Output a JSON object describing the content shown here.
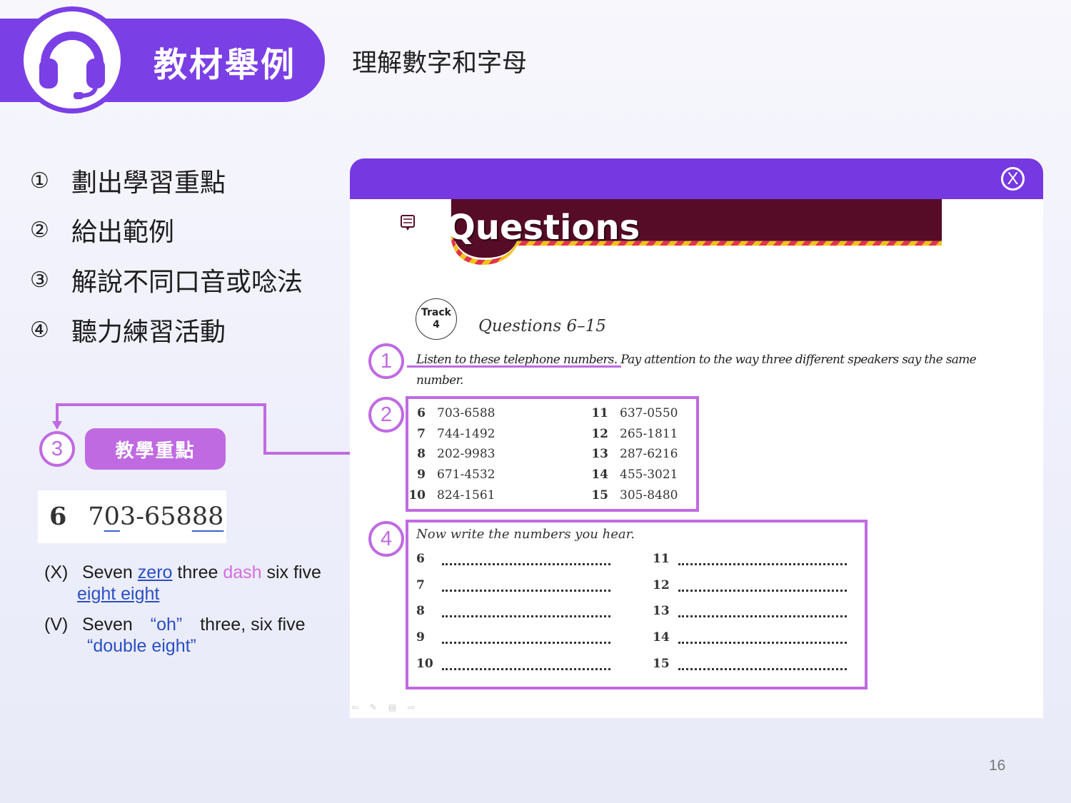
{
  "header": {
    "title": "教材舉例",
    "subtitle": "理解數字和字母",
    "icon": "headset-icon",
    "accent_color": "#7b3fe6"
  },
  "steps": [
    {
      "num": "①",
      "label": "劃出學習重點"
    },
    {
      "num": "②",
      "label": "給出範例"
    },
    {
      "num": "③",
      "label": "解說不同口音或唸法"
    },
    {
      "num": "④",
      "label": "聽力練習活動"
    }
  ],
  "callout": {
    "number": "3",
    "label": "教學重點",
    "color": "#c06ae2"
  },
  "example": {
    "index": "6",
    "number_parts": [
      "7",
      "0",
      "3-658",
      "88"
    ]
  },
  "wrong": {
    "mark": "(X)",
    "words": [
      "Seven",
      "zero",
      "three",
      "dash",
      "six five",
      "eight eight"
    ]
  },
  "right": {
    "mark": "(V)",
    "words": [
      "Seven",
      "“oh”",
      "three, six five",
      "“double eight”"
    ]
  },
  "window": {
    "close_label": "X",
    "title": "Questions",
    "title_icon": "headphones-chat-icon",
    "track_label": "Track",
    "track_number": "4",
    "question_range": "Questions 6–15",
    "instruction_part1": "Listen to these telephone numbers.",
    "instruction_part2": " Pay attention to the way three different speakers say the same number.",
    "callouts": [
      "1",
      "2",
      "4"
    ],
    "numbers_left": [
      {
        "n": "6",
        "phone": "703-6588"
      },
      {
        "n": "7",
        "phone": "744-1492"
      },
      {
        "n": "8",
        "phone": "202-9983"
      },
      {
        "n": "9",
        "phone": "671-4532"
      },
      {
        "n": "10",
        "phone": "824-1561"
      }
    ],
    "numbers_right": [
      {
        "n": "11",
        "phone": "637-0550"
      },
      {
        "n": "12",
        "phone": "265-1811"
      },
      {
        "n": "13",
        "phone": "287-6216"
      },
      {
        "n": "14",
        "phone": "455-3021"
      },
      {
        "n": "15",
        "phone": "305-8480"
      }
    ],
    "write_title": "Now write the numbers you hear.",
    "write_left": [
      "6",
      "7",
      "8",
      "9",
      "10"
    ],
    "write_right": [
      "11",
      "12",
      "13",
      "14",
      "15"
    ]
  },
  "page_number": "16"
}
